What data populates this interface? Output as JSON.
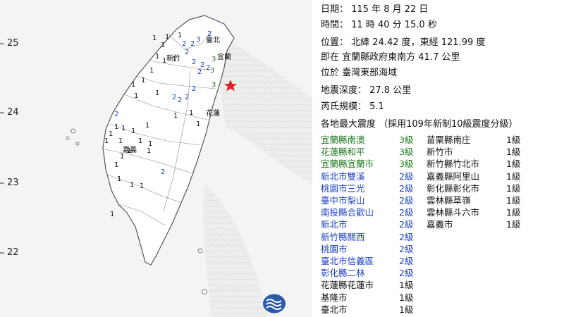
{
  "map": {
    "lat_labels": [
      "25",
      "24",
      "23",
      "22"
    ],
    "cities": [
      "新竹",
      "臺北",
      "宜蘭",
      "花蓮",
      "嘉義"
    ],
    "epicenter_color": "#e02020",
    "intensity_marks": [
      {
        "v": "2",
        "c": "blue"
      },
      {
        "v": "2",
        "c": "blue"
      },
      {
        "v": "3",
        "c": "blue"
      },
      {
        "v": "2",
        "c": "blue"
      },
      {
        "v": "3",
        "c": "green"
      },
      {
        "v": "3",
        "c": "green"
      },
      {
        "v": "3",
        "c": "green"
      },
      {
        "v": "2",
        "c": "blue"
      },
      {
        "v": "2",
        "c": "blue"
      },
      {
        "v": "2",
        "c": "blue"
      },
      {
        "v": "2",
        "c": "blue"
      },
      {
        "v": "2",
        "c": "blue"
      },
      {
        "v": "2",
        "c": "blue"
      },
      {
        "v": "2",
        "c": "blue"
      },
      {
        "v": "2",
        "c": "blue"
      },
      {
        "v": "2",
        "c": "blue"
      },
      {
        "v": "2",
        "c": "blue"
      },
      {
        "v": "2",
        "c": "blue"
      },
      {
        "v": "1",
        "c": "black"
      },
      {
        "v": "1",
        "c": "black"
      },
      {
        "v": "1",
        "c": "black"
      },
      {
        "v": "1",
        "c": "black"
      },
      {
        "v": "1",
        "c": "black"
      },
      {
        "v": "1",
        "c": "black"
      },
      {
        "v": "1",
        "c": "black"
      },
      {
        "v": "1",
        "c": "black"
      },
      {
        "v": "1",
        "c": "black"
      },
      {
        "v": "1",
        "c": "black"
      },
      {
        "v": "1",
        "c": "black"
      },
      {
        "v": "1",
        "c": "black"
      },
      {
        "v": "1",
        "c": "black"
      },
      {
        "v": "1",
        "c": "black"
      },
      {
        "v": "1",
        "c": "black"
      },
      {
        "v": "1",
        "c": "black"
      },
      {
        "v": "1",
        "c": "black"
      },
      {
        "v": "1",
        "c": "black"
      },
      {
        "v": "1",
        "c": "black"
      },
      {
        "v": "1",
        "c": "black"
      },
      {
        "v": "1",
        "c": "black"
      },
      {
        "v": "1",
        "c": "black"
      },
      {
        "v": "1",
        "c": "black"
      },
      {
        "v": "1",
        "c": "black"
      },
      {
        "v": "1",
        "c": "black"
      },
      {
        "v": "1",
        "c": "black"
      },
      {
        "v": "1",
        "c": "black"
      },
      {
        "v": "1",
        "c": "black"
      },
      {
        "v": "1",
        "c": "black"
      },
      {
        "v": "1",
        "c": "black"
      },
      {
        "v": "1",
        "c": "black"
      },
      {
        "v": "1",
        "c": "black"
      }
    ]
  },
  "info": {
    "date_line": "日期： 115  年  8  月  22  日",
    "time_line": "時間： 11  時  40  分  15.0  秒",
    "position_line": "位置：  北緯  24.42  度，東經  121.99  度",
    "near_line": "即在  宜蘭縣政府東南方  41.7  公里",
    "region_line": "位於  臺灣東部海域",
    "depth_line": "地震深度：  27.8  公里",
    "magnitude_line": "芮氏規模：  5.1",
    "heading_line": "各地最大震度 （採用109年新制10級震度分級）"
  },
  "list_left": [
    {
      "loc": "宜蘭縣南澳",
      "lv": "3級",
      "c": "green"
    },
    {
      "loc": "花蓮縣和平",
      "lv": "3級",
      "c": "green"
    },
    {
      "loc": "宜蘭縣宜蘭市",
      "lv": "3級",
      "c": "green"
    },
    {
      "loc": "新北市雙溪",
      "lv": "2級",
      "c": "blue"
    },
    {
      "loc": "桃園市三光",
      "lv": "2級",
      "c": "blue"
    },
    {
      "loc": "臺中市梨山",
      "lv": "2級",
      "c": "blue"
    },
    {
      "loc": "南投縣合歡山",
      "lv": "2級",
      "c": "blue"
    },
    {
      "loc": "新北市",
      "lv": "2級",
      "c": "blue"
    },
    {
      "loc": "新竹縣關西",
      "lv": "2級",
      "c": "blue"
    },
    {
      "loc": "桃園市",
      "lv": "2級",
      "c": "blue"
    },
    {
      "loc": "臺北市信義區",
      "lv": "2級",
      "c": "blue"
    },
    {
      "loc": "彰化縣二林",
      "lv": "2級",
      "c": "blue"
    },
    {
      "loc": "花蓮縣花蓮市",
      "lv": "1級",
      "c": "black"
    },
    {
      "loc": "基隆市",
      "lv": "1級",
      "c": "black"
    },
    {
      "loc": "臺北市",
      "lv": "1級",
      "c": "black"
    }
  ],
  "list_right": [
    {
      "loc": "苗栗縣南庄",
      "lv": "1級",
      "c": "black"
    },
    {
      "loc": "新竹市",
      "lv": "1級",
      "c": "black"
    },
    {
      "loc": "新竹縣竹北市",
      "lv": "1級",
      "c": "black"
    },
    {
      "loc": "嘉義縣阿里山",
      "lv": "1級",
      "c": "black"
    },
    {
      "loc": "彰化縣彰化市",
      "lv": "1級",
      "c": "black"
    },
    {
      "loc": "雲林縣草嶺",
      "lv": "1級",
      "c": "black"
    },
    {
      "loc": "雲林縣斗六市",
      "lv": "1級",
      "c": "black"
    },
    {
      "loc": "嘉義市",
      "lv": "1級",
      "c": "black"
    }
  ]
}
